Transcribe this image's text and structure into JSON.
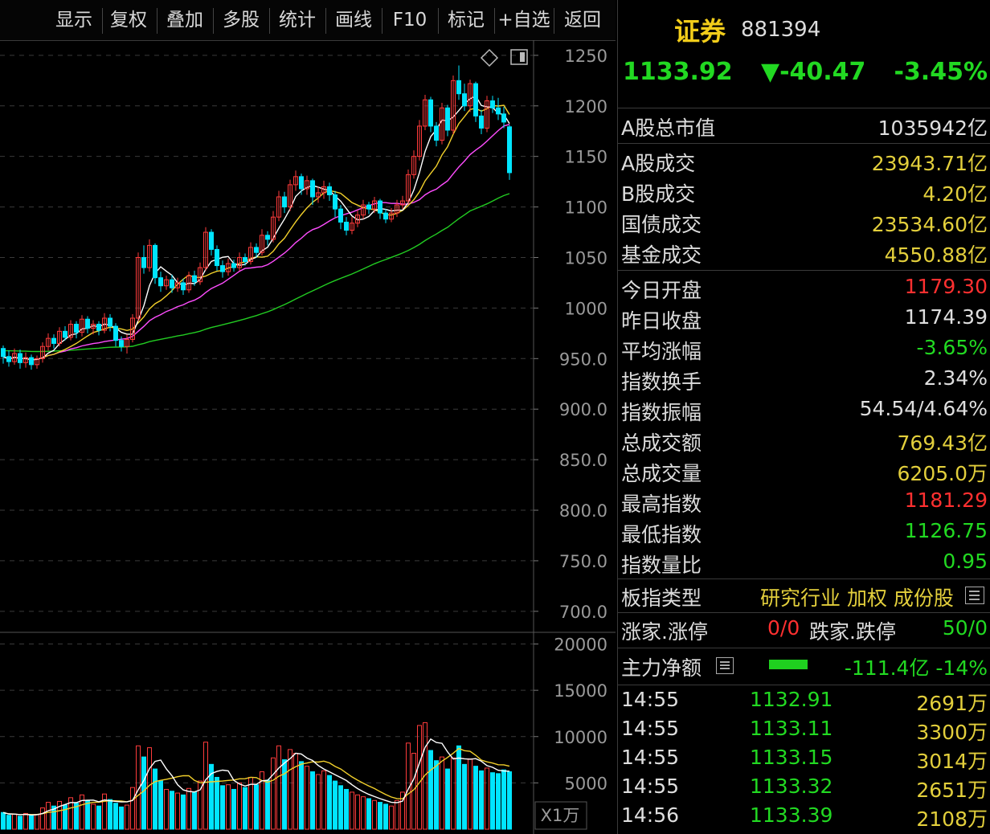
{
  "toolbar": {
    "buttons": [
      "显示",
      "复权",
      "叠加",
      "多股",
      "统计",
      "画线",
      "F10",
      "标记",
      "+自选",
      "返回"
    ]
  },
  "chart": {
    "price_ticks": [
      "1250",
      "1200",
      "1150",
      "1100",
      "1050",
      "1000",
      "950.0",
      "900.0",
      "850.0",
      "800.0",
      "750.0",
      "700.0"
    ],
    "volume_ticks": [
      "20000",
      "15000",
      "10000",
      "5000"
    ],
    "volume_unit": "X1万",
    "icons": [
      "diamond-icon",
      "panel-toggle-icon"
    ]
  },
  "chart_data": {
    "type": "candlestick",
    "price_axis": {
      "ylim": [
        680,
        1265
      ],
      "ticks": [
        1250,
        1200,
        1150,
        1100,
        1050,
        1000,
        950,
        900,
        850,
        800,
        750,
        700
      ]
    },
    "volume_axis": {
      "ylim": [
        0,
        21000
      ],
      "ticks": [
        20000,
        15000,
        10000,
        5000
      ],
      "unit": "X1万"
    },
    "colors": {
      "up": "#ff3b3b",
      "down": "#00e5ff",
      "ma5": "#ffffff",
      "ma10": "#f2d02b",
      "ma20": "#ff4dff",
      "ma60": "#22cc22"
    },
    "candles": [
      {
        "o": 960,
        "c": 952,
        "h": 963,
        "l": 945,
        "v": 1800
      },
      {
        "o": 952,
        "c": 947,
        "h": 958,
        "l": 942,
        "v": 1500
      },
      {
        "o": 947,
        "c": 955,
        "h": 960,
        "l": 944,
        "v": 1600
      },
      {
        "o": 955,
        "c": 946,
        "h": 959,
        "l": 940,
        "v": 1400
      },
      {
        "o": 946,
        "c": 951,
        "h": 956,
        "l": 941,
        "v": 1700
      },
      {
        "o": 951,
        "c": 944,
        "h": 954,
        "l": 939,
        "v": 1500
      },
      {
        "o": 944,
        "c": 950,
        "h": 953,
        "l": 940,
        "v": 1600
      },
      {
        "o": 950,
        "c": 962,
        "h": 966,
        "l": 946,
        "v": 2300
      },
      {
        "o": 962,
        "c": 970,
        "h": 975,
        "l": 958,
        "v": 2900
      },
      {
        "o": 970,
        "c": 965,
        "h": 974,
        "l": 960,
        "v": 2500
      },
      {
        "o": 965,
        "c": 977,
        "h": 981,
        "l": 962,
        "v": 3000
      },
      {
        "o": 977,
        "c": 971,
        "h": 982,
        "l": 968,
        "v": 2600
      },
      {
        "o": 971,
        "c": 984,
        "h": 988,
        "l": 968,
        "v": 3400
      },
      {
        "o": 984,
        "c": 976,
        "h": 987,
        "l": 970,
        "v": 2800
      },
      {
        "o": 976,
        "c": 989,
        "h": 993,
        "l": 972,
        "v": 3700
      },
      {
        "o": 989,
        "c": 980,
        "h": 992,
        "l": 975,
        "v": 3100
      },
      {
        "o": 980,
        "c": 984,
        "h": 988,
        "l": 974,
        "v": 2700
      },
      {
        "o": 984,
        "c": 978,
        "h": 987,
        "l": 973,
        "v": 2500
      },
      {
        "o": 978,
        "c": 990,
        "h": 995,
        "l": 975,
        "v": 3800
      },
      {
        "o": 990,
        "c": 982,
        "h": 994,
        "l": 977,
        "v": 3200
      },
      {
        "o": 982,
        "c": 968,
        "h": 985,
        "l": 962,
        "v": 2800
      },
      {
        "o": 968,
        "c": 962,
        "h": 972,
        "l": 957,
        "v": 2400
      },
      {
        "o": 962,
        "c": 969,
        "h": 974,
        "l": 955,
        "v": 2600
      },
      {
        "o": 969,
        "c": 990,
        "h": 994,
        "l": 966,
        "v": 4500
      },
      {
        "o": 990,
        "c": 1050,
        "h": 1055,
        "l": 987,
        "v": 9000
      },
      {
        "o": 1050,
        "c": 1040,
        "h": 1062,
        "l": 1034,
        "v": 7800
      },
      {
        "o": 1040,
        "c": 1062,
        "h": 1068,
        "l": 1036,
        "v": 8800
      },
      {
        "o": 1062,
        "c": 1030,
        "h": 1064,
        "l": 1024,
        "v": 6500
      },
      {
        "o": 1030,
        "c": 1022,
        "h": 1036,
        "l": 1016,
        "v": 5200
      },
      {
        "o": 1022,
        "c": 1028,
        "h": 1032,
        "l": 1018,
        "v": 4300
      },
      {
        "o": 1028,
        "c": 1020,
        "h": 1033,
        "l": 1015,
        "v": 4100
      },
      {
        "o": 1020,
        "c": 1025,
        "h": 1030,
        "l": 1016,
        "v": 3900
      },
      {
        "o": 1025,
        "c": 1018,
        "h": 1029,
        "l": 1013,
        "v": 3700
      },
      {
        "o": 1018,
        "c": 1032,
        "h": 1036,
        "l": 1015,
        "v": 4400
      },
      {
        "o": 1032,
        "c": 1026,
        "h": 1037,
        "l": 1022,
        "v": 4000
      },
      {
        "o": 1026,
        "c": 1040,
        "h": 1045,
        "l": 1023,
        "v": 5200
      },
      {
        "o": 1040,
        "c": 1075,
        "h": 1080,
        "l": 1037,
        "v": 9400
      },
      {
        "o": 1075,
        "c": 1058,
        "h": 1078,
        "l": 1052,
        "v": 7000
      },
      {
        "o": 1058,
        "c": 1042,
        "h": 1062,
        "l": 1037,
        "v": 5600
      },
      {
        "o": 1042,
        "c": 1036,
        "h": 1047,
        "l": 1030,
        "v": 4700
      },
      {
        "o": 1036,
        "c": 1044,
        "h": 1049,
        "l": 1032,
        "v": 4800
      },
      {
        "o": 1044,
        "c": 1040,
        "h": 1048,
        "l": 1036,
        "v": 4300
      },
      {
        "o": 1040,
        "c": 1050,
        "h": 1055,
        "l": 1037,
        "v": 5000
      },
      {
        "o": 1050,
        "c": 1046,
        "h": 1054,
        "l": 1042,
        "v": 4500
      },
      {
        "o": 1046,
        "c": 1060,
        "h": 1065,
        "l": 1043,
        "v": 5600
      },
      {
        "o": 1060,
        "c": 1055,
        "h": 1064,
        "l": 1050,
        "v": 4800
      },
      {
        "o": 1055,
        "c": 1072,
        "h": 1078,
        "l": 1052,
        "v": 6200
      },
      {
        "o": 1072,
        "c": 1068,
        "h": 1076,
        "l": 1062,
        "v": 5300
      },
      {
        "o": 1068,
        "c": 1090,
        "h": 1096,
        "l": 1065,
        "v": 7700
      },
      {
        "o": 1090,
        "c": 1110,
        "h": 1116,
        "l": 1086,
        "v": 9000
      },
      {
        "o": 1110,
        "c": 1100,
        "h": 1115,
        "l": 1094,
        "v": 7500
      },
      {
        "o": 1100,
        "c": 1122,
        "h": 1127,
        "l": 1096,
        "v": 8600
      },
      {
        "o": 1122,
        "c": 1130,
        "h": 1136,
        "l": 1116,
        "v": 8200
      },
      {
        "o": 1130,
        "c": 1118,
        "h": 1133,
        "l": 1112,
        "v": 7300
      },
      {
        "o": 1118,
        "c": 1126,
        "h": 1131,
        "l": 1112,
        "v": 6800
      },
      {
        "o": 1126,
        "c": 1110,
        "h": 1128,
        "l": 1102,
        "v": 6200
      },
      {
        "o": 1110,
        "c": 1114,
        "h": 1120,
        "l": 1104,
        "v": 5900
      },
      {
        "o": 1114,
        "c": 1120,
        "h": 1126,
        "l": 1108,
        "v": 6300
      },
      {
        "o": 1120,
        "c": 1112,
        "h": 1124,
        "l": 1106,
        "v": 5800
      },
      {
        "o": 1112,
        "c": 1098,
        "h": 1116,
        "l": 1090,
        "v": 5200
      },
      {
        "o": 1098,
        "c": 1085,
        "h": 1102,
        "l": 1078,
        "v": 4700
      },
      {
        "o": 1085,
        "c": 1077,
        "h": 1090,
        "l": 1072,
        "v": 4300
      },
      {
        "o": 1077,
        "c": 1084,
        "h": 1090,
        "l": 1073,
        "v": 4000
      },
      {
        "o": 1084,
        "c": 1092,
        "h": 1097,
        "l": 1080,
        "v": 3700
      },
      {
        "o": 1092,
        "c": 1102,
        "h": 1107,
        "l": 1088,
        "v": 3500
      },
      {
        "o": 1102,
        "c": 1098,
        "h": 1105,
        "l": 1093,
        "v": 3300
      },
      {
        "o": 1098,
        "c": 1106,
        "h": 1110,
        "l": 1094,
        "v": 3100
      },
      {
        "o": 1106,
        "c": 1094,
        "h": 1108,
        "l": 1088,
        "v": 2900
      },
      {
        "o": 1094,
        "c": 1088,
        "h": 1098,
        "l": 1084,
        "v": 2700
      },
      {
        "o": 1088,
        "c": 1094,
        "h": 1099,
        "l": 1085,
        "v": 2500
      },
      {
        "o": 1094,
        "c": 1102,
        "h": 1107,
        "l": 1090,
        "v": 3100
      },
      {
        "o": 1102,
        "c": 1106,
        "h": 1111,
        "l": 1098,
        "v": 4000
      },
      {
        "o": 1106,
        "c": 1132,
        "h": 1137,
        "l": 1103,
        "v": 9300
      },
      {
        "o": 1132,
        "c": 1150,
        "h": 1156,
        "l": 1128,
        "v": 8200
      },
      {
        "o": 1150,
        "c": 1180,
        "h": 1186,
        "l": 1146,
        "v": 11200
      },
      {
        "o": 1180,
        "c": 1206,
        "h": 1211,
        "l": 1176,
        "v": 11500
      },
      {
        "o": 1206,
        "c": 1180,
        "h": 1209,
        "l": 1174,
        "v": 8500
      },
      {
        "o": 1180,
        "c": 1166,
        "h": 1184,
        "l": 1160,
        "v": 7400
      },
      {
        "o": 1166,
        "c": 1198,
        "h": 1203,
        "l": 1162,
        "v": 7800
      },
      {
        "o": 1198,
        "c": 1176,
        "h": 1201,
        "l": 1170,
        "v": 6500
      },
      {
        "o": 1176,
        "c": 1225,
        "h": 1230,
        "l": 1172,
        "v": 7700
      },
      {
        "o": 1225,
        "c": 1212,
        "h": 1240,
        "l": 1206,
        "v": 9000
      },
      {
        "o": 1212,
        "c": 1200,
        "h": 1222,
        "l": 1195,
        "v": 7000
      },
      {
        "o": 1200,
        "c": 1222,
        "h": 1226,
        "l": 1194,
        "v": 7600
      },
      {
        "o": 1222,
        "c": 1190,
        "h": 1224,
        "l": 1184,
        "v": 6800
      },
      {
        "o": 1190,
        "c": 1178,
        "h": 1196,
        "l": 1172,
        "v": 6300
      },
      {
        "o": 1178,
        "c": 1205,
        "h": 1210,
        "l": 1174,
        "v": 6600
      },
      {
        "o": 1205,
        "c": 1198,
        "h": 1210,
        "l": 1193,
        "v": 6100
      },
      {
        "o": 1198,
        "c": 1192,
        "h": 1208,
        "l": 1186,
        "v": 6000
      },
      {
        "o": 1192,
        "c": 1184,
        "h": 1199,
        "l": 1178,
        "v": 6400
      },
      {
        "o": 1179.3,
        "c": 1133.92,
        "h": 1181.29,
        "l": 1126.75,
        "v": 6205
      }
    ]
  },
  "panel": {
    "title": "证券",
    "code": "881394",
    "price": "1133.92",
    "change": "▼-40.47",
    "change_pct": "-3.45%",
    "market_cap": {
      "label": "A股总市值",
      "value": "1035942亿"
    },
    "turnover": [
      {
        "label": "A股成交",
        "value": "23943.71亿"
      },
      {
        "label": "B股成交",
        "value": "4.20亿"
      },
      {
        "label": "国债成交",
        "value": "23534.60亿"
      },
      {
        "label": "基金成交",
        "value": "4550.88亿"
      }
    ],
    "stats": [
      {
        "label": "今日开盘",
        "value": "1179.30",
        "color": "red"
      },
      {
        "label": "昨日收盘",
        "value": "1174.39",
        "color": "white"
      },
      {
        "label": "平均涨幅",
        "value": "-3.65%",
        "color": "green"
      },
      {
        "label": "指数换手",
        "value": "2.34%",
        "color": "white"
      },
      {
        "label": "指数振幅",
        "value": "54.54/4.64%",
        "color": "white"
      },
      {
        "label": "总成交额",
        "value": "769.43亿",
        "color": "yellow"
      },
      {
        "label": "总成交量",
        "value": "6205.0万",
        "color": "yellow"
      },
      {
        "label": "最高指数",
        "value": "1181.29",
        "color": "red"
      },
      {
        "label": "最低指数",
        "value": "1126.75",
        "color": "green"
      },
      {
        "label": "指数量比",
        "value": "0.95",
        "color": "green"
      }
    ],
    "index_type": {
      "label": "板指类型",
      "value": "研究行业 加权 成份股"
    },
    "rise_fall": {
      "label1": "涨家.涨停",
      "value1": "0/0",
      "label2": "跌家.跌停",
      "value2": "50/0"
    },
    "main_force": {
      "label": "主力净额",
      "value": "-111.4亿 -14%",
      "bar_fraction": 0.14
    },
    "ticks": [
      {
        "time": "14:55",
        "price": "1132.91",
        "volume": "2691万"
      },
      {
        "time": "14:55",
        "price": "1133.11",
        "volume": "3300万"
      },
      {
        "time": "14:55",
        "price": "1133.15",
        "volume": "3014万"
      },
      {
        "time": "14:55",
        "price": "1133.32",
        "volume": "2651万"
      },
      {
        "time": "14:56",
        "price": "1133.39",
        "volume": "2108万"
      }
    ]
  }
}
